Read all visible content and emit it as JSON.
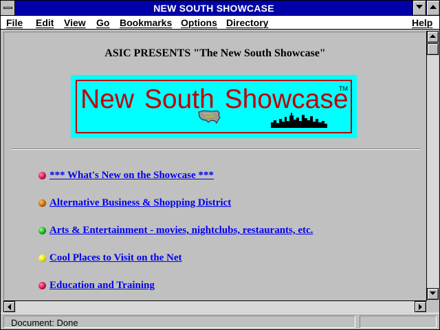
{
  "window": {
    "title": "NEW SOUTH SHOWCASE"
  },
  "menu": {
    "items": [
      {
        "label": "File"
      },
      {
        "label": "Edit"
      },
      {
        "label": "View"
      },
      {
        "label": "Go"
      },
      {
        "label": "Bookmarks"
      },
      {
        "label": "Options"
      },
      {
        "label": "Directory"
      },
      {
        "label": "Help"
      }
    ]
  },
  "page": {
    "heading": "ASIC PRESENTS \"The New South Showcase\"",
    "logo": {
      "text": "New South Showcase",
      "trademark": "TM",
      "icons": [
        "usa-map-icon",
        "city-skyline-icon"
      ],
      "colors": {
        "background": "#00ffff",
        "text": "#c00000",
        "border": "#c00000"
      }
    },
    "links": [
      {
        "label": "*** What's New on the Showcase ***",
        "bullet_color": "#d0104a"
      },
      {
        "label": "Alternative Business & Shopping District",
        "bullet_color": "#c86400"
      },
      {
        "label": "Arts & Entertainment - movies, nightclubs, restaurants, etc.",
        "bullet_color": "#10b010"
      },
      {
        "label": "Cool Places to Visit on the Net",
        "bullet_color": "#e8e000"
      },
      {
        "label": "Education and Training",
        "bullet_color": "#d0104a"
      }
    ],
    "link_color": "#0000ee"
  },
  "status": {
    "text": "Document: Done"
  },
  "colors": {
    "titlebar": "#0000a8",
    "chrome": "#c0c0c0"
  }
}
